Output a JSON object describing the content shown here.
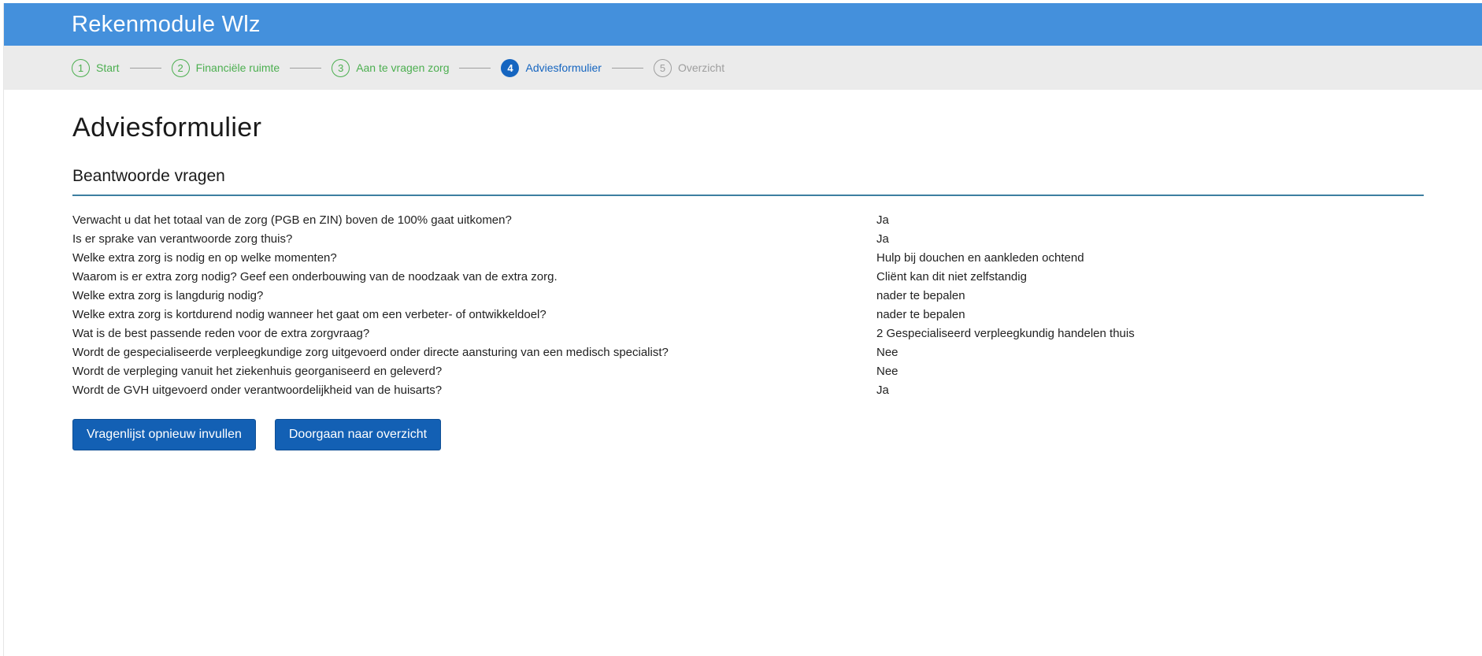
{
  "app": {
    "title": "Rekenmodule Wlz"
  },
  "colors": {
    "brand": "#4490dc",
    "done": "#4caf50",
    "active": "#1565c0",
    "todo": "#9e9e9e",
    "button": "#1360b4"
  },
  "steps": [
    {
      "num": "1",
      "label": "Start",
      "state": "done"
    },
    {
      "num": "2",
      "label": "Financiële ruimte",
      "state": "done"
    },
    {
      "num": "3",
      "label": "Aan te vragen zorg",
      "state": "done"
    },
    {
      "num": "4",
      "label": "Adviesformulier",
      "state": "active"
    },
    {
      "num": "5",
      "label": "Overzicht",
      "state": "todo"
    }
  ],
  "page": {
    "title": "Adviesformulier",
    "section_title": "Beantwoorde vragen"
  },
  "answers": [
    {
      "question": "Verwacht u dat het totaal van de zorg (PGB en ZIN) boven de 100% gaat uitkomen?",
      "answer": "Ja"
    },
    {
      "question": "Is er sprake van verantwoorde zorg thuis?",
      "answer": "Ja"
    },
    {
      "question": "Welke extra zorg is nodig en op welke momenten?",
      "answer": "Hulp bij douchen en aankleden ochtend"
    },
    {
      "question": "Waarom is er extra zorg nodig? Geef een onderbouwing van de noodzaak van de extra zorg.",
      "answer": "Cliënt kan dit niet zelfstandig"
    },
    {
      "question": "Welke extra zorg is langdurig nodig?",
      "answer": "nader te bepalen"
    },
    {
      "question": "Welke extra zorg is kortdurend nodig wanneer het gaat om een verbeter- of ontwikkeldoel?",
      "answer": "nader te bepalen"
    },
    {
      "question": "Wat is de best passende reden voor de extra zorgvraag?",
      "answer": "2 Gespecialiseerd verpleegkundig handelen thuis"
    },
    {
      "question": "Wordt de gespecialiseerde verpleegkundige zorg uitgevoerd onder directe aansturing van een medisch specialist?",
      "answer": "Nee"
    },
    {
      "question": "Wordt de verpleging vanuit het ziekenhuis georganiseerd en geleverd?",
      "answer": "Nee"
    },
    {
      "question": "Wordt de GVH uitgevoerd onder verantwoordelijkheid van de huisarts?",
      "answer": "Ja"
    }
  ],
  "actions": {
    "restart_label": "Vragenlijst opnieuw invullen",
    "continue_label": "Doorgaan naar overzicht"
  }
}
